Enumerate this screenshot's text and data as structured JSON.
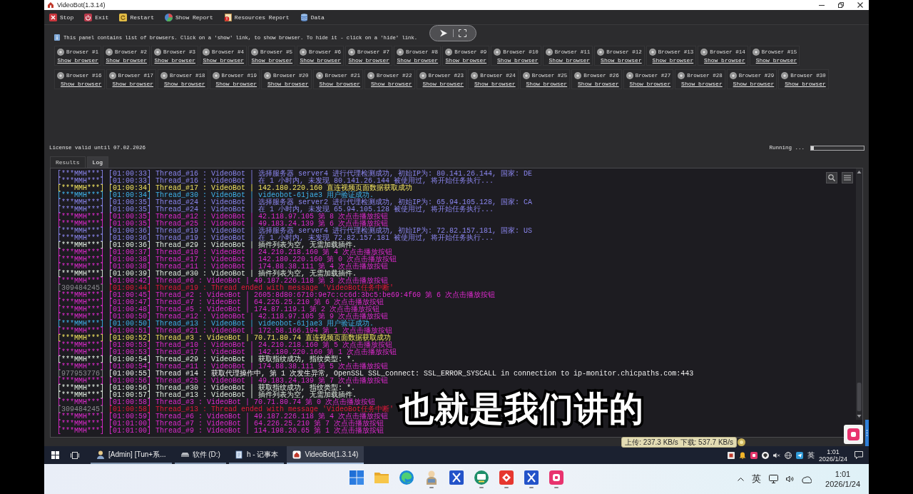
{
  "window": {
    "title": "VideoBot(1.3.14)"
  },
  "toolbar": [
    {
      "label": "Stop",
      "kind": "stop"
    },
    {
      "label": "Exit",
      "kind": "exit"
    },
    {
      "label": "Restart",
      "kind": "restart"
    },
    {
      "label": "Show Report",
      "kind": "report"
    },
    {
      "label": "Resources Report",
      "kind": "resources"
    },
    {
      "label": "Data",
      "kind": "data"
    }
  ],
  "browser_panel": {
    "hint": "This panel contains list of browsers. Click on a 'show' link, to show browser. To hide it - click on a 'hide' link.",
    "rows": [
      [
        {
          "label": "Browser #1",
          "link": "Show browser"
        },
        {
          "label": "Browser #2",
          "link": "Show browser"
        },
        {
          "label": "Browser #3",
          "link": "Show browser"
        },
        {
          "label": "Browser #4",
          "link": "Show browser"
        },
        {
          "label": "Browser #5",
          "link": "Show browser"
        },
        {
          "label": "Browser #6",
          "link": "Show browser"
        },
        {
          "label": "Browser #7",
          "link": "Show browser"
        },
        {
          "label": "Browser #8",
          "link": "Show browser"
        },
        {
          "label": "Browser #9",
          "link": "Show browser"
        },
        {
          "label": "Browser #10",
          "link": "Show browser"
        },
        {
          "label": "Browser #11",
          "link": "Show browser"
        },
        {
          "label": "Browser #12",
          "link": "Show browser"
        },
        {
          "label": "Browser #13",
          "link": "Show browser"
        },
        {
          "label": "Browser #14",
          "link": "Show browser"
        },
        {
          "label": "Browser #15",
          "link": "Show browser"
        }
      ],
      [
        {
          "label": "Browser #16",
          "link": "Show browser"
        },
        {
          "label": "Browser #17",
          "link": "Show browser"
        },
        {
          "label": "Browser #18",
          "link": "Show browser"
        },
        {
          "label": "Browser #19",
          "link": "Show browser"
        },
        {
          "label": "Browser #20",
          "link": "Show browser"
        },
        {
          "label": "Browser #21",
          "link": "Show browser"
        },
        {
          "label": "Browser #22",
          "link": "Show browser"
        },
        {
          "label": "Browser #23",
          "link": "Show browser"
        },
        {
          "label": "Browser #24",
          "link": "Show browser"
        },
        {
          "label": "Browser #25",
          "link": "Show browser"
        },
        {
          "label": "Browser #26",
          "link": "Show browser"
        },
        {
          "label": "Browser #27",
          "link": "Show browser"
        },
        {
          "label": "Browser #28",
          "link": "Show browser"
        },
        {
          "label": "Browser #29",
          "link": "Show browser"
        },
        {
          "label": "Browser #30",
          "link": "Show browser"
        }
      ]
    ]
  },
  "license": "License valid until 07.02.2026",
  "status": {
    "text": "Running ...",
    "level": 0.05
  },
  "tabs": [
    {
      "label": "Results",
      "selected": false
    },
    {
      "label": "Log",
      "selected": true
    }
  ],
  "log": [
    {
      "tag": "[***MMH***]",
      "kind": "proxy",
      "text": "[01:00:33] Thread_#16 : VideoBot | 选择服务器 server4 进行代理检测成功, 初始IP为: 80.141.26.144, 国家: DE"
    },
    {
      "tag": "[***MMH***]",
      "kind": "proxy",
      "text": "[01:00:33] Thread_#16 : VideoBot | 在 1 小时内, 未发现 80.141.26.144 被使用过, 将开始任务执行..."
    },
    {
      "tag": "[***MMH***]",
      "kind": "success",
      "text": "[01:00:34] Thread_#17 : VideoBot | 142.180.220.160 直连视频页面数据获取成功"
    },
    {
      "tag": "[***MMH***]",
      "kind": "auth",
      "text": "[01:00:34] Thread_#30 : VideoBot | videobot-61jae3 用户验证成功."
    },
    {
      "tag": "[***MMH***]",
      "kind": "proxy",
      "text": "[01:00:35] Thread_#24 : VideoBot | 选择服务器 server2 进行代理检测成功, 初始IP为: 65.94.105.128, 国家: CA"
    },
    {
      "tag": "[***MMH***]",
      "kind": "proxy",
      "text": "[01:00:35] Thread_#24 : VideoBot | 在 1 小时内, 未发现 65.94.105.128 被使用过, 将开始任务执行..."
    },
    {
      "tag": "[***MMH***]",
      "kind": "click",
      "text": "[01:00:35] Thread_#12 : VideoBot | 42.118.97.105 第 8 次点击播放按钮"
    },
    {
      "tag": "[***MMH***]",
      "kind": "click",
      "text": "[01:00:35] Thread_#25 : VideoBot | 49.183.24.139 第 6 次点击播放按钮"
    },
    {
      "tag": "[***MMH***]",
      "kind": "proxy",
      "text": "[01:00:36] Thread_#19 : VideoBot | 选择服务器 server4 进行代理检测成功, 初始IP为: 72.82.157.181, 国家: US"
    },
    {
      "tag": "[***MMH***]",
      "kind": "proxy",
      "text": "[01:00:36] Thread_#19 : VideoBot | 在 1 小时内, 未发现 72.82.157.181 被使用过, 将开始任务执行..."
    },
    {
      "tag": "[***MMH***]",
      "kind": "info",
      "text": "[01:00:36] Thread_#29 : VideoBot | 插件列表为空, 无需加载插件."
    },
    {
      "tag": "[***MMH***]",
      "kind": "click",
      "text": "[01:00:37] Thread_#10 : VideoBot | 24.210.218.160 第 4 次点击播放按钮"
    },
    {
      "tag": "[***MMH***]",
      "kind": "click",
      "text": "[01:00:38] Thread_#17 : VideoBot | 142.180.220.160 第 0 次点击播放按钮"
    },
    {
      "tag": "[***MMH***]",
      "kind": "click",
      "text": "[01:00:38] Thread_#11 : VideoBot | 174.88.38.111 第 4 次点击播放按钮"
    },
    {
      "tag": "[***MMH***]",
      "kind": "info",
      "text": "[01:00:39] Thread_#30 : VideoBot | 插件列表为空, 无需加载插件."
    },
    {
      "tag": "[***MMH***]",
      "kind": "click",
      "text": "[01:00:42] Thread_#6 : VideoBot | 49.187.226.118 第 3 次点击播放按钮"
    },
    {
      "tag": "[309484245]",
      "kind": "error",
      "text": "[01:00:44] Thread_#19 : Thread ended with message 'VideoBot任务中断'"
    },
    {
      "tag": "[***MMH***]",
      "kind": "click",
      "text": "[01:00:45] Thread_#2 : VideoBot | 2605:8d80:6710:9e7c:cc6d:3bc5:be69:4f60 第 6 次点击播放按钮"
    },
    {
      "tag": "[***MMH***]",
      "kind": "click",
      "text": "[01:00:47] Thread_#7 : VideoBot | 64.226.25.210 第 6 次点击播放按钮"
    },
    {
      "tag": "[***MMH***]",
      "kind": "click",
      "text": "[01:00:48] Thread_#5 : VideoBot | 174.87.119.1 第 2 次点击播放按钮"
    },
    {
      "tag": "[***MMH***]",
      "kind": "click",
      "text": "[01:00:50] Thread_#12 : VideoBot | 42.118.97.105 第 9 次点击播放按钮"
    },
    {
      "tag": "[***MMH***]",
      "kind": "auth",
      "text": "[01:00:50] Thread_#13 : VideoBot | videobot-61jae3 用户验证成功."
    },
    {
      "tag": "[***MMH***]",
      "kind": "click",
      "text": "[01:00:51] Thread_#21 : VideoBot | 172.58.166.194 第 1 次点击播放按钮"
    },
    {
      "tag": "[***MMH***]",
      "kind": "success",
      "text": "[01:00:52] Thread_#3 : VideoBot | 70.71.80.74 直连视频页面数据获取成功"
    },
    {
      "tag": "[***MMH***]",
      "kind": "click",
      "text": "[01:00:53] Thread_#10 : VideoBot | 24.210.218.160 第 5 次点击播放按钮"
    },
    {
      "tag": "[***MMH***]",
      "kind": "click",
      "text": "[01:00:53] Thread_#17 : VideoBot | 142.180.220.160 第 1 次点击播放按钮"
    },
    {
      "tag": "[***MMH***]",
      "kind": "info",
      "text": "[01:00:54] Thread_#29 : VideoBot | 获取指纹成功, 指纹类型: *."
    },
    {
      "tag": "[***MMH***]",
      "kind": "click",
      "text": "[01:00:54] Thread_#11 : VideoBot | 174.88.38.111 第 5 次点击播放按钮"
    },
    {
      "tag": "[977953776]",
      "kind": "exception",
      "text": "[01:00:55] Thread #14 : 获取代理操作中, 第 1 次发生异常, OpenSSL SSL_connect: SSL_ERROR_SYSCALL in connection to ip-monitor.chicpaths.com:443"
    },
    {
      "tag": "[***MMH***]",
      "kind": "click",
      "text": "[01:00:56] Thread_#25 : VideoBot | 49.183.24.139 第 7 次点击播放按钮"
    },
    {
      "tag": "[***MMH***]",
      "kind": "info",
      "text": "[01:00:56] Thread_#30 : VideoBot | 获取指纹成功, 指纹类型: *."
    },
    {
      "tag": "[***MMH***]",
      "kind": "info",
      "text": "[01:00:57] Thread_#13 : VideoBot | 插件列表为空, 无需加载插件."
    },
    {
      "tag": "[***MMH***]",
      "kind": "click",
      "text": "[01:00:58] Thread_#3 : VideoBot | 70.71.80.74 第 0 次点击播放按钮"
    },
    {
      "tag": "[309484245]",
      "kind": "error",
      "text": "[01:00:58] Thread_#13 : Thread ended with message 'VideoBot任务中断'"
    },
    {
      "tag": "[***MMH***]",
      "kind": "click",
      "text": "[01:00:59] Thread_#6 : VideoBot | 49.187.226.118 第 4 次点击播放按钮"
    },
    {
      "tag": "[***MMH***]",
      "kind": "click",
      "text": "[01:01:00] Thread_#7 : VideoBot | 64.226.25.210 第 7 次点击播放按钮"
    },
    {
      "tag": "[***MMH***]",
      "kind": "click",
      "text": "[01:01:00] Thread_#9 : VideoBot | 114.198.20.65 第 1 次点击播放按钮"
    }
  ],
  "network_speed": "上传: 237.3 KB/s 下载: 537.7 KB/s",
  "subtitle": "也就是我们讲的",
  "remote_taskbar": {
    "apps": [
      {
        "label": "[Admin] [Tun+系...",
        "kind": "admin",
        "selected": false
      },
      {
        "label": "软件 (D:)",
        "kind": "drive",
        "selected": false
      },
      {
        "label": "h - 记事本",
        "kind": "notepad",
        "selected": false
      },
      {
        "label": "VideoBot(1.3.14)",
        "kind": "videobot",
        "selected": true
      }
    ],
    "ime": "英",
    "time": "1:01",
    "date": "2026/1/24"
  },
  "local_taskbar": {
    "apps": [
      {
        "kind": "start",
        "running": false
      },
      {
        "kind": "folder",
        "running": false
      },
      {
        "kind": "swirl",
        "running": false
      },
      {
        "kind": "figure",
        "running": true
      },
      {
        "kind": "xtile",
        "running": false
      },
      {
        "kind": "tv",
        "running": true
      },
      {
        "kind": "diamond",
        "running": true
      },
      {
        "kind": "xtile",
        "running": true
      },
      {
        "kind": "pinktile",
        "running": true
      }
    ],
    "ime": "英",
    "time": "1:01",
    "date": "2026/1/24"
  }
}
